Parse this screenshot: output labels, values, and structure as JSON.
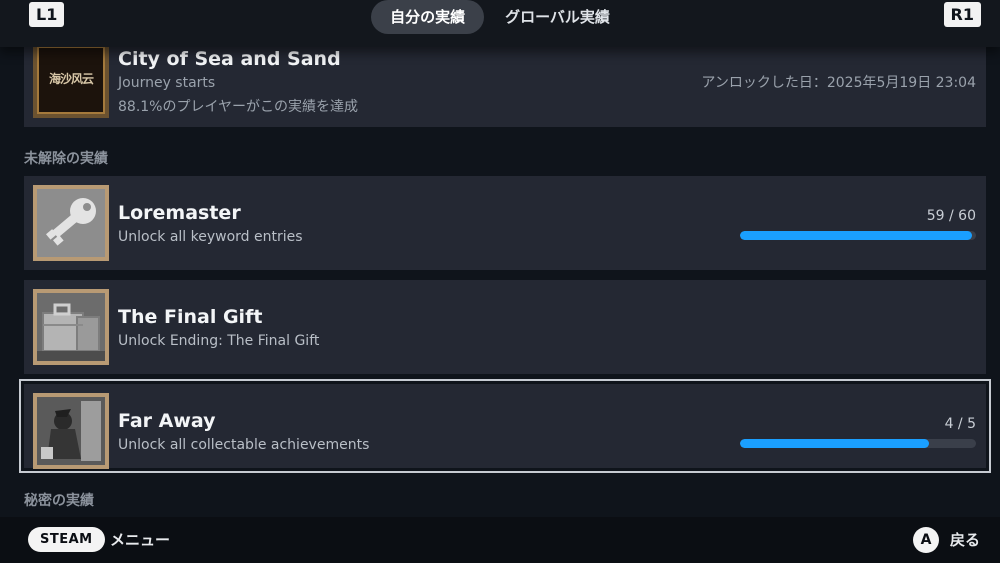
{
  "top": {
    "left_shoulder": "L1",
    "right_shoulder": "R1",
    "tabs": [
      {
        "label": "自分の実績",
        "active": true
      },
      {
        "label": "グローバル実績",
        "active": false
      }
    ]
  },
  "unlocked": [
    {
      "title": "City of Sea and Sand",
      "description": "Journey starts",
      "global_percent_text": "88.1%のプレイヤーがこの実績を達成",
      "unlock_text": "アンロックした日：2025年5月19日 23:04",
      "icon_text": "海沙风云",
      "icon": "city-of-sea-and-sand-art"
    }
  ],
  "locked_section_label": "未解除の実績",
  "locked": [
    {
      "title": "Loremaster",
      "description": "Unlock all keyword entries",
      "progress_text": "59 / 60",
      "progress": 0.983,
      "icon": "key-icon"
    },
    {
      "title": "The Final Gift",
      "description": "Unlock Ending: The Final Gift",
      "icon": "suitcase-icon"
    },
    {
      "title": "Far Away",
      "description": "Unlock all collectable achievements",
      "progress_text": "4 / 5",
      "progress": 0.8,
      "icon": "figure-art"
    }
  ],
  "secret_section_label": "秘密の実績",
  "footer": {
    "steam_label": "STEAM",
    "menu_label": "メニュー",
    "a_label": "A",
    "back_label": "戻る"
  },
  "colors": {
    "progress_fill": "#1a9fff",
    "card_bg": "#242833",
    "icon_frame": "#b89a74"
  }
}
